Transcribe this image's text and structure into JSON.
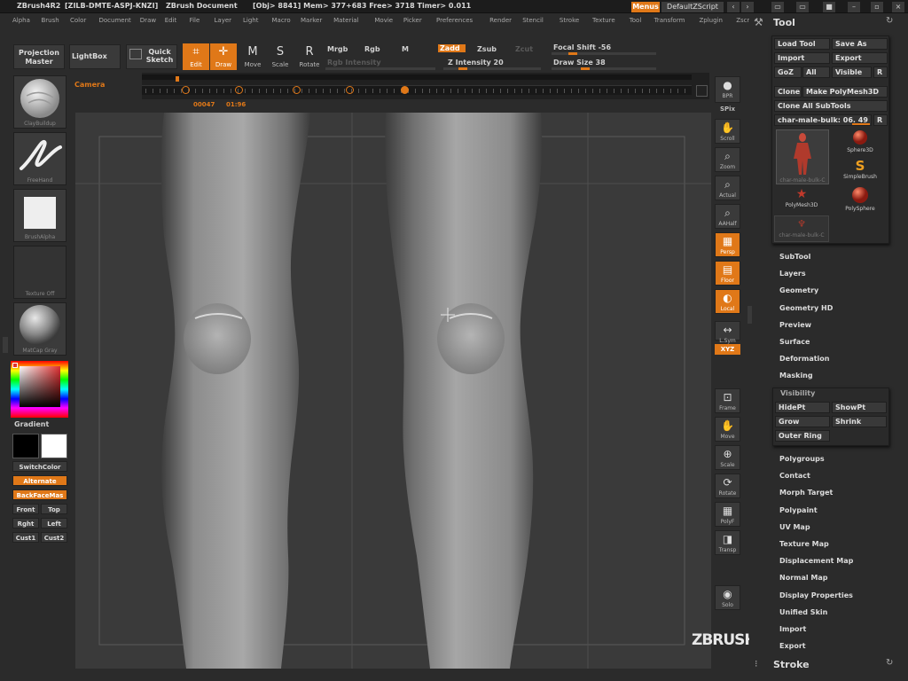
{
  "titlebar": {
    "app": "ZBrush4R2",
    "serial": "[ZILB-DMTE-ASPJ-KNZI]",
    "document": "ZBrush Document",
    "stats": "[Obj> 8841] Mem> 377+683  Free> 3718  Timer> 0.011",
    "menus_label": "Menus",
    "zscript_label": "DefaultZScript"
  },
  "menubar": [
    "Alpha",
    "Brush",
    "Color",
    "Document",
    "Draw",
    "Edit",
    "File",
    "Layer",
    "Light",
    "Macro",
    "Marker",
    "Material",
    "Movie",
    "Picker",
    "Preferences",
    "Render",
    "Stencil",
    "Stroke",
    "Texture",
    "Tool",
    "Transform",
    "Zplugin",
    "Zscript"
  ],
  "shelf": {
    "projection_master": "Projection Master",
    "lightbox": "LightBox",
    "quick_sketch": "Quick Sketch",
    "tools": [
      {
        "label": "Edit",
        "icon": "edit-icon",
        "active": true
      },
      {
        "label": "Draw",
        "icon": "draw-icon",
        "active": true
      },
      {
        "label": "Move",
        "icon": "move-icon",
        "active": false
      },
      {
        "label": "Scale",
        "icon": "scale-icon",
        "active": false
      },
      {
        "label": "Rotate",
        "icon": "rotate-icon",
        "active": false
      }
    ],
    "mrgb": "Mrgb",
    "rgb": "Rgb",
    "m": "M",
    "rgb_intensity": "Rgb Intensity",
    "zadd": "Zadd",
    "zsub": "Zsub",
    "zcut": "Zcut",
    "z_intensity_label": "Z Intensity 20",
    "z_intensity_value": 20,
    "focal_shift_label": "Focal Shift -56",
    "focal_shift_value": -56,
    "draw_size_label": "Draw Size 38",
    "draw_size_value": 38
  },
  "timeline": {
    "camera_label": "Camera",
    "time_current": "00047",
    "time_total": "01:96"
  },
  "left_tray": {
    "brush_label": "ClayBuildup",
    "stroke_label": "FreeHand",
    "alpha_label": "BrushAlpha",
    "texture_label": "Texture Off",
    "material_label": "MatCap Gray",
    "gradient_label": "Gradient",
    "switch_color_label": "SwitchColor",
    "alternate_label": "Alternate",
    "backface_label": "BackFaceMas",
    "view_buttons": [
      "Front",
      "Top",
      "Rght",
      "Left",
      "Cust1",
      "Cust2"
    ]
  },
  "right_shelf": [
    {
      "label": "BPR",
      "icon": "bpr-icon",
      "active": false
    },
    {
      "label": "SPix",
      "icon": "spix-icon",
      "active": false
    },
    {
      "label": "Scroll",
      "icon": "scroll-icon",
      "active": false
    },
    {
      "label": "Zoom",
      "icon": "zoom-icon",
      "active": false
    },
    {
      "label": "Actual",
      "icon": "actual-icon",
      "active": false
    },
    {
      "label": "AAHalf",
      "icon": "aahalf-icon",
      "active": false
    },
    {
      "label": "Persp",
      "icon": "persp-icon",
      "active": true
    },
    {
      "label": "Floor",
      "icon": "floor-icon",
      "active": true
    },
    {
      "label": "Local",
      "icon": "local-icon",
      "active": true
    },
    {
      "label": "L.Sym",
      "icon": "lsym-icon",
      "active": false
    },
    {
      "label": "XYZ",
      "icon": "xyz-icon",
      "active": true
    },
    {
      "label": "Frame",
      "icon": "frame-icon",
      "active": false
    },
    {
      "label": "Move",
      "icon": "move-icon",
      "active": false
    },
    {
      "label": "Scale",
      "icon": "scale-icon",
      "active": false
    },
    {
      "label": "Rotate",
      "icon": "rotate-icon",
      "active": false
    },
    {
      "label": "PolyF",
      "icon": "polyf-icon",
      "active": false
    },
    {
      "label": "Transp",
      "icon": "transp-icon",
      "active": false
    },
    {
      "label": "Solo",
      "icon": "solo-icon",
      "active": false
    }
  ],
  "tool_palette": {
    "title": "Tool",
    "load_tool": "Load Tool",
    "save_as": "Save As",
    "import": "Import",
    "export": "Export",
    "goz": "GoZ",
    "all": "All",
    "visible": "Visible",
    "r": "R",
    "clone": "Clone",
    "make_polymesh": "Make PolyMesh3D",
    "clone_all": "Clone All SubTools",
    "current_tool": "char-male-bulk: 06. 49",
    "subtools": [
      {
        "label": "char-male-bulk-C",
        "icon": "figure-icon"
      },
      {
        "label": "Sphere3D",
        "icon": "sphere-icon"
      },
      {
        "label": "SimpleBrush",
        "icon": "simplebrush-icon"
      },
      {
        "label": "PolyMesh3D",
        "icon": "star-icon"
      },
      {
        "label": "PolySphere",
        "icon": "sphere-icon"
      },
      {
        "label": "char-male-bulk-C",
        "icon": "figure-icon"
      }
    ],
    "sections_top": [
      "SubTool",
      "Layers",
      "Geometry",
      "Geometry HD",
      "Preview",
      "Surface",
      "Deformation",
      "Masking"
    ],
    "visibility": {
      "title": "Visibility",
      "hidept": "HidePt",
      "showpt": "ShowPt",
      "grow": "Grow",
      "shrink": "Shrink",
      "outer_ring": "Outer Ring"
    },
    "sections_bottom": [
      "Polygroups",
      "Contact",
      "Morph Target",
      "Polypaint",
      "UV Map",
      "Texture Map",
      "Displacement Map",
      "Normal Map",
      "Display Properties",
      "Unified Skin",
      "Import",
      "Export"
    ],
    "stroke_title": "Stroke"
  },
  "watermark": "ZBRUSH WORKSHOPS",
  "colors": {
    "accent": "#e07818",
    "background": "#2b2b2b",
    "canvas": "#3a3a3a"
  }
}
